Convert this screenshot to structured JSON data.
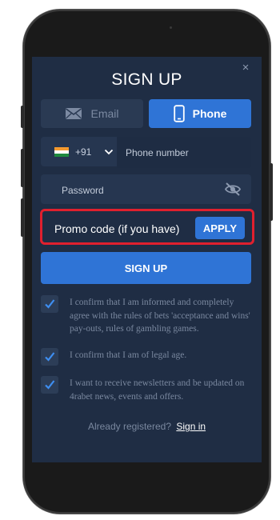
{
  "modal": {
    "title": "SIGN UP",
    "close_label": "×"
  },
  "tabs": [
    {
      "label": "Email",
      "icon": "envelope-icon",
      "active": false
    },
    {
      "label": "Phone",
      "icon": "smartphone-icon",
      "active": true
    }
  ],
  "phone_field": {
    "country_icon": "india-flag-icon",
    "dial_code": "+91",
    "placeholder": "Phone number"
  },
  "password_field": {
    "placeholder": "Password",
    "toggle_icon": "eye-off-icon"
  },
  "promo": {
    "placeholder": "Promo code (if you have)",
    "apply_label": "APPLY",
    "highlight_color": "#e0202e"
  },
  "signup_button": {
    "label": "SIGN UP"
  },
  "checkboxes": [
    {
      "text": "I confirm that I am informed and completely agree with the rules of bets 'acceptance and wins' pay-outs, rules of gambling games.",
      "checked": true
    },
    {
      "text": "I confirm that I am of legal age.",
      "checked": true
    },
    {
      "text": "I want to receive newsletters and be updated on 4rabet news, events and offers.",
      "checked": true
    }
  ],
  "footer": {
    "prompt": "Already registered?",
    "link": "Sign in"
  },
  "colors": {
    "background": "#1f2d44",
    "accent": "#2f74d6",
    "field": "#263650",
    "muted_text": "#7a889f"
  }
}
